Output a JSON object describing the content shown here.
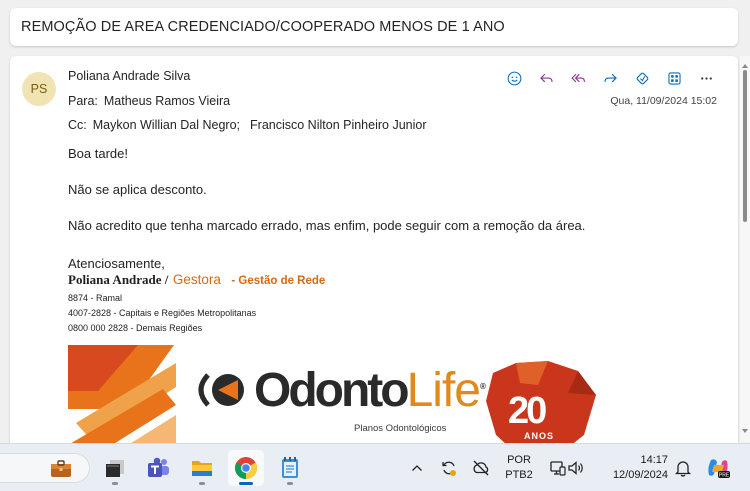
{
  "subject": "REMOÇÃO DE AREA CREDENCIADO/COOPERADO MENOS DE 1 ANO",
  "message": {
    "avatar_initials": "PS",
    "sender": "Poliana Andrade Silva",
    "to_label": "Para:",
    "to": "Matheus Ramos Vieira",
    "cc_label": "Cc:",
    "cc": [
      "Maykon Willian Dal Negro;",
      "Francisco Nilton Pinheiro Junior"
    ],
    "date": "Qua, 11/09/2024 15:02",
    "actions": [
      "emoji-icon",
      "reply-icon",
      "reply-all-icon",
      "forward-icon",
      "apps-icon",
      "grid-icon",
      "more-icon"
    ]
  },
  "body": {
    "greeting": "Boa tarde!",
    "line1": "Não se aplica desconto.",
    "line2": "Não acredito que tenha marcado errado, mas enfim, pode seguir com a remoção da área.",
    "closing": "Atenciosamente,",
    "sig_name": "Poliana Andrade /",
    "sig_role": "Gestora",
    "sig_dept": "- Gestão de Rede",
    "phones": [
      "8874 - Ramal",
      "4007-2828 - Capitais e Regiões Metropolitanas",
      "0800 000 2828 - Demais Regiões"
    ]
  },
  "logo": {
    "brand_a": "Odonto",
    "brand_b": "Life",
    "tagline": "Planos Odontológicos",
    "badge_number": "20",
    "badge_word": "ANOS",
    "brand_colors": {
      "orange": "#e8731b",
      "red": "#c9361c",
      "dark": "#2a2a2a"
    }
  },
  "taskbar": {
    "apps": [
      "briefcase-icon",
      "app-window-icon",
      "teams-icon",
      "file-explorer-icon",
      "chrome-icon",
      "notepad-icon"
    ],
    "lang_top": "POR",
    "lang_bottom": "PTB2",
    "time": "14:17",
    "date": "12/09/2024"
  },
  "colors": {
    "accent": "#0f6cbd",
    "background": "#f0f0f0",
    "card": "#ffffff"
  }
}
